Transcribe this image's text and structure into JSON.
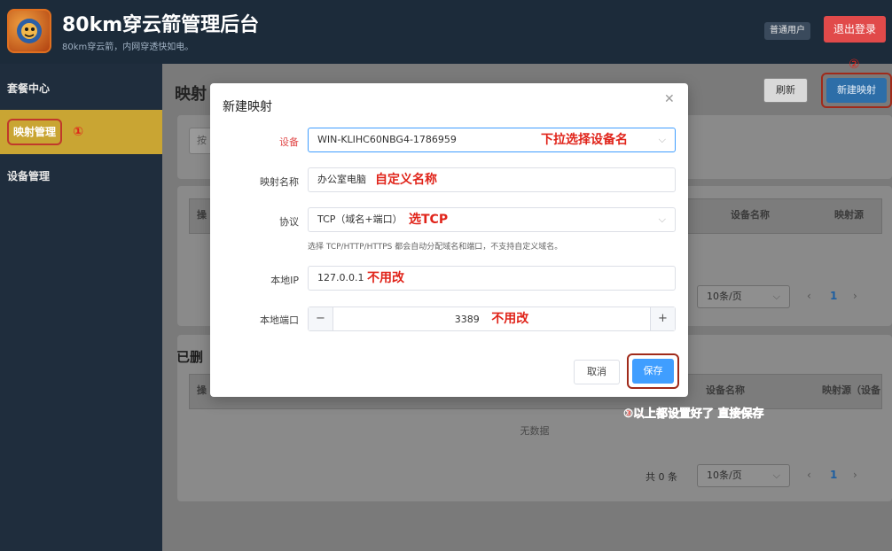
{
  "header": {
    "title": "80km穿云箭管理后台",
    "subtitle": "80km穿云箭，内网穿透快如电。",
    "user_badge": "普通用户",
    "logout_label": "退出登录"
  },
  "sidebar": {
    "items": [
      {
        "label": "套餐中心"
      },
      {
        "label": "映射管理"
      },
      {
        "label": "设备管理"
      }
    ],
    "active_annotation": "①"
  },
  "main": {
    "page_title": "映射",
    "refresh_label": "刷新",
    "new_label": "新建映射",
    "new_annotation": "②",
    "filter_placeholder": "按",
    "table1": {
      "columns": [
        "操",
        "设备名称",
        "映射源"
      ],
      "page_size": "10条/页",
      "current_page": "1"
    },
    "section2_title": "已删",
    "table2": {
      "columns": [
        "操",
        "设备名称",
        "映射源（设备"
      ],
      "empty_text": "无数据",
      "total": "共 0 条",
      "page_size": "10条/页",
      "current_page": "1"
    }
  },
  "modal": {
    "title": "新建映射",
    "fields": {
      "device": {
        "label": "设备",
        "value": "WIN-KLIHC60NBG4-1786959",
        "annotation": "下拉选择设备名"
      },
      "name": {
        "label": "映射名称",
        "value": "办公室电脑",
        "annotation": "自定义名称"
      },
      "protocol": {
        "label": "协议",
        "value": "TCP（域名+端口）",
        "annotation": "选TCP",
        "hint": "选择 TCP/HTTP/HTTPS 都会自动分配域名和端口，不支持自定义域名。"
      },
      "local_ip": {
        "label": "本地IP",
        "value": "127.0.0.1",
        "annotation": "不用改"
      },
      "local_port": {
        "label": "本地端口",
        "value": "3389",
        "annotation": "不用改"
      }
    },
    "cancel_label": "取消",
    "save_label": "保存"
  },
  "overlay_annotation": "③以上都设置好了 直接保存",
  "colors": {
    "header_bg": "#1c2b3a",
    "active_nav": "#c9a533",
    "primary": "#409eff",
    "danger": "#e14a4a",
    "annotation_red": "#e0241a"
  }
}
